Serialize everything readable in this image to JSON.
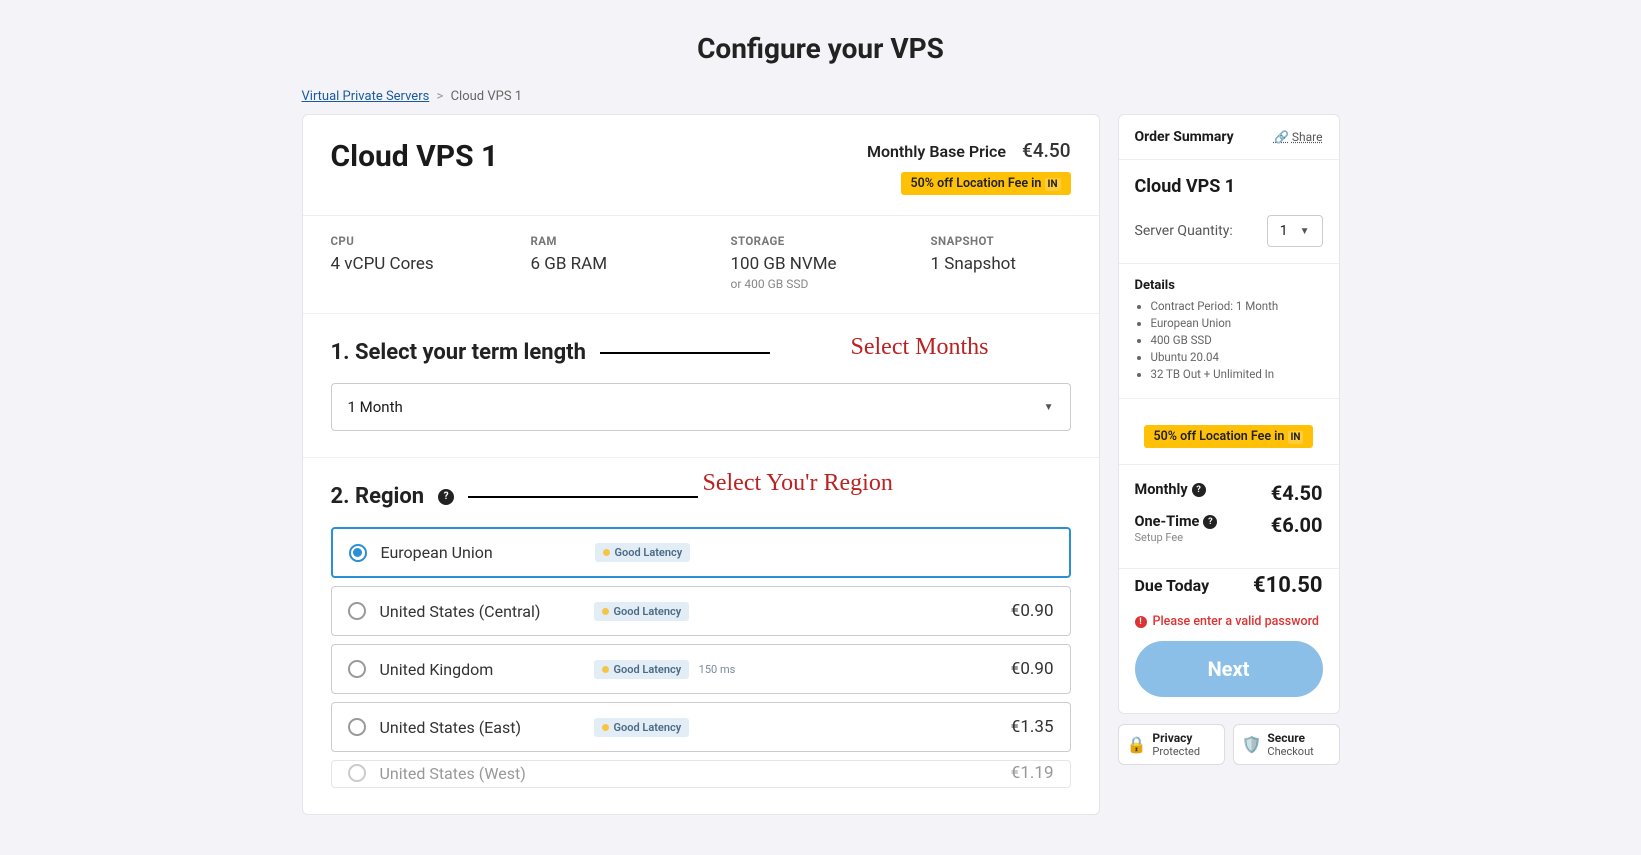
{
  "page_title": "Configure your VPS",
  "breadcrumb": {
    "root": "Virtual Private Servers",
    "current": "Cloud VPS 1"
  },
  "product": {
    "name": "Cloud VPS 1",
    "price_label": "Monthly Base Price",
    "price_value": "€4.50",
    "promo": "50% off Location Fee in",
    "promo_flag": "IN"
  },
  "specs": {
    "cpu_label": "CPU",
    "cpu_value": "4 vCPU Cores",
    "ram_label": "RAM",
    "ram_value": "6 GB RAM",
    "storage_label": "STORAGE",
    "storage_value": "100 GB NVMe",
    "storage_sub": "or 400 GB SSD",
    "snapshot_label": "SNAPSHOT",
    "snapshot_value": "1 Snapshot"
  },
  "section1": {
    "title": "1. Select your term length",
    "selected": "1 Month",
    "annotation": "Select Months"
  },
  "section2": {
    "title": "2. Region",
    "annotation": "Select You'r Region",
    "regions": [
      {
        "name": "European Union",
        "latency": "Good Latency",
        "ms": "",
        "price": "",
        "selected": true
      },
      {
        "name": "United States (Central)",
        "latency": "Good Latency",
        "ms": "",
        "price": "€0.90",
        "selected": false
      },
      {
        "name": "United Kingdom",
        "latency": "Good Latency",
        "ms": "150 ms",
        "price": "€0.90",
        "selected": false
      },
      {
        "name": "United States (East)",
        "latency": "Good Latency",
        "ms": "",
        "price": "€1.35",
        "selected": false
      },
      {
        "name": "United States (West)",
        "latency": "",
        "ms": "",
        "price": "€1.19",
        "selected": false
      }
    ]
  },
  "summary": {
    "title": "Order Summary",
    "share": "Share",
    "product": "Cloud VPS 1",
    "qty_label": "Server Quantity:",
    "qty_value": "1",
    "details_title": "Details",
    "details": [
      "Contract Period: 1 Month",
      "European Union",
      "400 GB SSD",
      "Ubuntu 20.04",
      "32 TB Out + Unlimited In"
    ],
    "promo": "50% off Location Fee in",
    "promo_flag": "IN",
    "monthly_label": "Monthly",
    "monthly_value": "€4.50",
    "onetime_label": "One-Time",
    "onetime_sub": "Setup Fee",
    "onetime_value": "€6.00",
    "due_label": "Due Today",
    "due_value": "€10.50",
    "error": "Please enter a valid password",
    "next": "Next"
  },
  "secbadges": {
    "privacy_t": "Privacy",
    "privacy_s": "Protected",
    "secure_t": "Secure",
    "secure_s": "Checkout"
  }
}
